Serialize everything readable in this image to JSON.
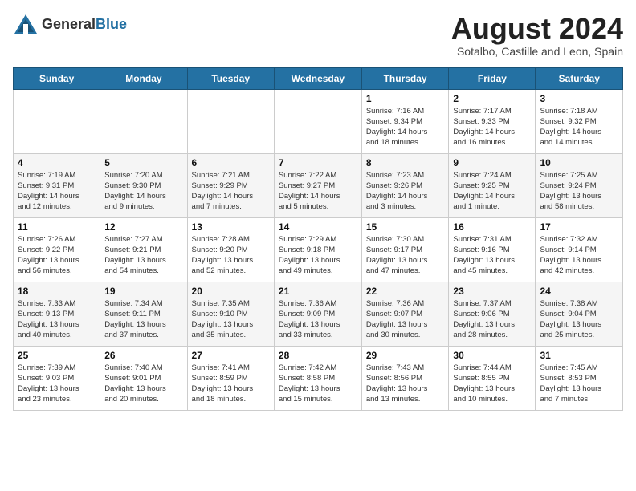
{
  "logo": {
    "general": "General",
    "blue": "Blue"
  },
  "title": "August 2024",
  "location": "Sotalbo, Castille and Leon, Spain",
  "days_of_week": [
    "Sunday",
    "Monday",
    "Tuesday",
    "Wednesday",
    "Thursday",
    "Friday",
    "Saturday"
  ],
  "weeks": [
    [
      {
        "day": "",
        "info": ""
      },
      {
        "day": "",
        "info": ""
      },
      {
        "day": "",
        "info": ""
      },
      {
        "day": "",
        "info": ""
      },
      {
        "day": "1",
        "info": "Sunrise: 7:16 AM\nSunset: 9:34 PM\nDaylight: 14 hours\nand 18 minutes."
      },
      {
        "day": "2",
        "info": "Sunrise: 7:17 AM\nSunset: 9:33 PM\nDaylight: 14 hours\nand 16 minutes."
      },
      {
        "day": "3",
        "info": "Sunrise: 7:18 AM\nSunset: 9:32 PM\nDaylight: 14 hours\nand 14 minutes."
      }
    ],
    [
      {
        "day": "4",
        "info": "Sunrise: 7:19 AM\nSunset: 9:31 PM\nDaylight: 14 hours\nand 12 minutes."
      },
      {
        "day": "5",
        "info": "Sunrise: 7:20 AM\nSunset: 9:30 PM\nDaylight: 14 hours\nand 9 minutes."
      },
      {
        "day": "6",
        "info": "Sunrise: 7:21 AM\nSunset: 9:29 PM\nDaylight: 14 hours\nand 7 minutes."
      },
      {
        "day": "7",
        "info": "Sunrise: 7:22 AM\nSunset: 9:27 PM\nDaylight: 14 hours\nand 5 minutes."
      },
      {
        "day": "8",
        "info": "Sunrise: 7:23 AM\nSunset: 9:26 PM\nDaylight: 14 hours\nand 3 minutes."
      },
      {
        "day": "9",
        "info": "Sunrise: 7:24 AM\nSunset: 9:25 PM\nDaylight: 14 hours\nand 1 minute."
      },
      {
        "day": "10",
        "info": "Sunrise: 7:25 AM\nSunset: 9:24 PM\nDaylight: 13 hours\nand 58 minutes."
      }
    ],
    [
      {
        "day": "11",
        "info": "Sunrise: 7:26 AM\nSunset: 9:22 PM\nDaylight: 13 hours\nand 56 minutes."
      },
      {
        "day": "12",
        "info": "Sunrise: 7:27 AM\nSunset: 9:21 PM\nDaylight: 13 hours\nand 54 minutes."
      },
      {
        "day": "13",
        "info": "Sunrise: 7:28 AM\nSunset: 9:20 PM\nDaylight: 13 hours\nand 52 minutes."
      },
      {
        "day": "14",
        "info": "Sunrise: 7:29 AM\nSunset: 9:18 PM\nDaylight: 13 hours\nand 49 minutes."
      },
      {
        "day": "15",
        "info": "Sunrise: 7:30 AM\nSunset: 9:17 PM\nDaylight: 13 hours\nand 47 minutes."
      },
      {
        "day": "16",
        "info": "Sunrise: 7:31 AM\nSunset: 9:16 PM\nDaylight: 13 hours\nand 45 minutes."
      },
      {
        "day": "17",
        "info": "Sunrise: 7:32 AM\nSunset: 9:14 PM\nDaylight: 13 hours\nand 42 minutes."
      }
    ],
    [
      {
        "day": "18",
        "info": "Sunrise: 7:33 AM\nSunset: 9:13 PM\nDaylight: 13 hours\nand 40 minutes."
      },
      {
        "day": "19",
        "info": "Sunrise: 7:34 AM\nSunset: 9:11 PM\nDaylight: 13 hours\nand 37 minutes."
      },
      {
        "day": "20",
        "info": "Sunrise: 7:35 AM\nSunset: 9:10 PM\nDaylight: 13 hours\nand 35 minutes."
      },
      {
        "day": "21",
        "info": "Sunrise: 7:36 AM\nSunset: 9:09 PM\nDaylight: 13 hours\nand 33 minutes."
      },
      {
        "day": "22",
        "info": "Sunrise: 7:36 AM\nSunset: 9:07 PM\nDaylight: 13 hours\nand 30 minutes."
      },
      {
        "day": "23",
        "info": "Sunrise: 7:37 AM\nSunset: 9:06 PM\nDaylight: 13 hours\nand 28 minutes."
      },
      {
        "day": "24",
        "info": "Sunrise: 7:38 AM\nSunset: 9:04 PM\nDaylight: 13 hours\nand 25 minutes."
      }
    ],
    [
      {
        "day": "25",
        "info": "Sunrise: 7:39 AM\nSunset: 9:03 PM\nDaylight: 13 hours\nand 23 minutes."
      },
      {
        "day": "26",
        "info": "Sunrise: 7:40 AM\nSunset: 9:01 PM\nDaylight: 13 hours\nand 20 minutes."
      },
      {
        "day": "27",
        "info": "Sunrise: 7:41 AM\nSunset: 8:59 PM\nDaylight: 13 hours\nand 18 minutes."
      },
      {
        "day": "28",
        "info": "Sunrise: 7:42 AM\nSunset: 8:58 PM\nDaylight: 13 hours\nand 15 minutes."
      },
      {
        "day": "29",
        "info": "Sunrise: 7:43 AM\nSunset: 8:56 PM\nDaylight: 13 hours\nand 13 minutes."
      },
      {
        "day": "30",
        "info": "Sunrise: 7:44 AM\nSunset: 8:55 PM\nDaylight: 13 hours\nand 10 minutes."
      },
      {
        "day": "31",
        "info": "Sunrise: 7:45 AM\nSunset: 8:53 PM\nDaylight: 13 hours\nand 7 minutes."
      }
    ]
  ]
}
